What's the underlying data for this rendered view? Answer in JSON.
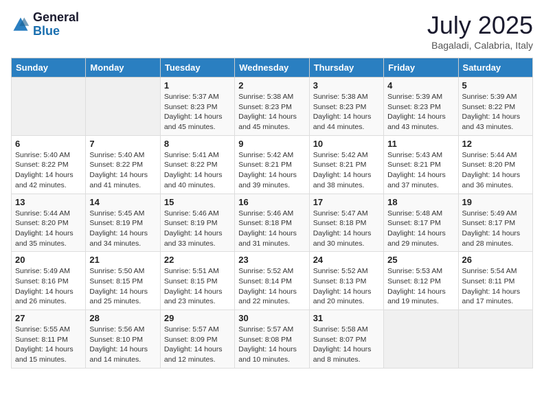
{
  "header": {
    "logo_general": "General",
    "logo_blue": "Blue",
    "month_title": "July 2025",
    "subtitle": "Bagaladi, Calabria, Italy"
  },
  "weekdays": [
    "Sunday",
    "Monday",
    "Tuesday",
    "Wednesday",
    "Thursday",
    "Friday",
    "Saturday"
  ],
  "weeks": [
    [
      {
        "day": "",
        "info": ""
      },
      {
        "day": "",
        "info": ""
      },
      {
        "day": "1",
        "info": "Sunrise: 5:37 AM\nSunset: 8:23 PM\nDaylight: 14 hours and 45 minutes."
      },
      {
        "day": "2",
        "info": "Sunrise: 5:38 AM\nSunset: 8:23 PM\nDaylight: 14 hours and 45 minutes."
      },
      {
        "day": "3",
        "info": "Sunrise: 5:38 AM\nSunset: 8:23 PM\nDaylight: 14 hours and 44 minutes."
      },
      {
        "day": "4",
        "info": "Sunrise: 5:39 AM\nSunset: 8:23 PM\nDaylight: 14 hours and 43 minutes."
      },
      {
        "day": "5",
        "info": "Sunrise: 5:39 AM\nSunset: 8:22 PM\nDaylight: 14 hours and 43 minutes."
      }
    ],
    [
      {
        "day": "6",
        "info": "Sunrise: 5:40 AM\nSunset: 8:22 PM\nDaylight: 14 hours and 42 minutes."
      },
      {
        "day": "7",
        "info": "Sunrise: 5:40 AM\nSunset: 8:22 PM\nDaylight: 14 hours and 41 minutes."
      },
      {
        "day": "8",
        "info": "Sunrise: 5:41 AM\nSunset: 8:22 PM\nDaylight: 14 hours and 40 minutes."
      },
      {
        "day": "9",
        "info": "Sunrise: 5:42 AM\nSunset: 8:21 PM\nDaylight: 14 hours and 39 minutes."
      },
      {
        "day": "10",
        "info": "Sunrise: 5:42 AM\nSunset: 8:21 PM\nDaylight: 14 hours and 38 minutes."
      },
      {
        "day": "11",
        "info": "Sunrise: 5:43 AM\nSunset: 8:21 PM\nDaylight: 14 hours and 37 minutes."
      },
      {
        "day": "12",
        "info": "Sunrise: 5:44 AM\nSunset: 8:20 PM\nDaylight: 14 hours and 36 minutes."
      }
    ],
    [
      {
        "day": "13",
        "info": "Sunrise: 5:44 AM\nSunset: 8:20 PM\nDaylight: 14 hours and 35 minutes."
      },
      {
        "day": "14",
        "info": "Sunrise: 5:45 AM\nSunset: 8:19 PM\nDaylight: 14 hours and 34 minutes."
      },
      {
        "day": "15",
        "info": "Sunrise: 5:46 AM\nSunset: 8:19 PM\nDaylight: 14 hours and 33 minutes."
      },
      {
        "day": "16",
        "info": "Sunrise: 5:46 AM\nSunset: 8:18 PM\nDaylight: 14 hours and 31 minutes."
      },
      {
        "day": "17",
        "info": "Sunrise: 5:47 AM\nSunset: 8:18 PM\nDaylight: 14 hours and 30 minutes."
      },
      {
        "day": "18",
        "info": "Sunrise: 5:48 AM\nSunset: 8:17 PM\nDaylight: 14 hours and 29 minutes."
      },
      {
        "day": "19",
        "info": "Sunrise: 5:49 AM\nSunset: 8:17 PM\nDaylight: 14 hours and 28 minutes."
      }
    ],
    [
      {
        "day": "20",
        "info": "Sunrise: 5:49 AM\nSunset: 8:16 PM\nDaylight: 14 hours and 26 minutes."
      },
      {
        "day": "21",
        "info": "Sunrise: 5:50 AM\nSunset: 8:15 PM\nDaylight: 14 hours and 25 minutes."
      },
      {
        "day": "22",
        "info": "Sunrise: 5:51 AM\nSunset: 8:15 PM\nDaylight: 14 hours and 23 minutes."
      },
      {
        "day": "23",
        "info": "Sunrise: 5:52 AM\nSunset: 8:14 PM\nDaylight: 14 hours and 22 minutes."
      },
      {
        "day": "24",
        "info": "Sunrise: 5:52 AM\nSunset: 8:13 PM\nDaylight: 14 hours and 20 minutes."
      },
      {
        "day": "25",
        "info": "Sunrise: 5:53 AM\nSunset: 8:12 PM\nDaylight: 14 hours and 19 minutes."
      },
      {
        "day": "26",
        "info": "Sunrise: 5:54 AM\nSunset: 8:11 PM\nDaylight: 14 hours and 17 minutes."
      }
    ],
    [
      {
        "day": "27",
        "info": "Sunrise: 5:55 AM\nSunset: 8:11 PM\nDaylight: 14 hours and 15 minutes."
      },
      {
        "day": "28",
        "info": "Sunrise: 5:56 AM\nSunset: 8:10 PM\nDaylight: 14 hours and 14 minutes."
      },
      {
        "day": "29",
        "info": "Sunrise: 5:57 AM\nSunset: 8:09 PM\nDaylight: 14 hours and 12 minutes."
      },
      {
        "day": "30",
        "info": "Sunrise: 5:57 AM\nSunset: 8:08 PM\nDaylight: 14 hours and 10 minutes."
      },
      {
        "day": "31",
        "info": "Sunrise: 5:58 AM\nSunset: 8:07 PM\nDaylight: 14 hours and 8 minutes."
      },
      {
        "day": "",
        "info": ""
      },
      {
        "day": "",
        "info": ""
      }
    ]
  ]
}
